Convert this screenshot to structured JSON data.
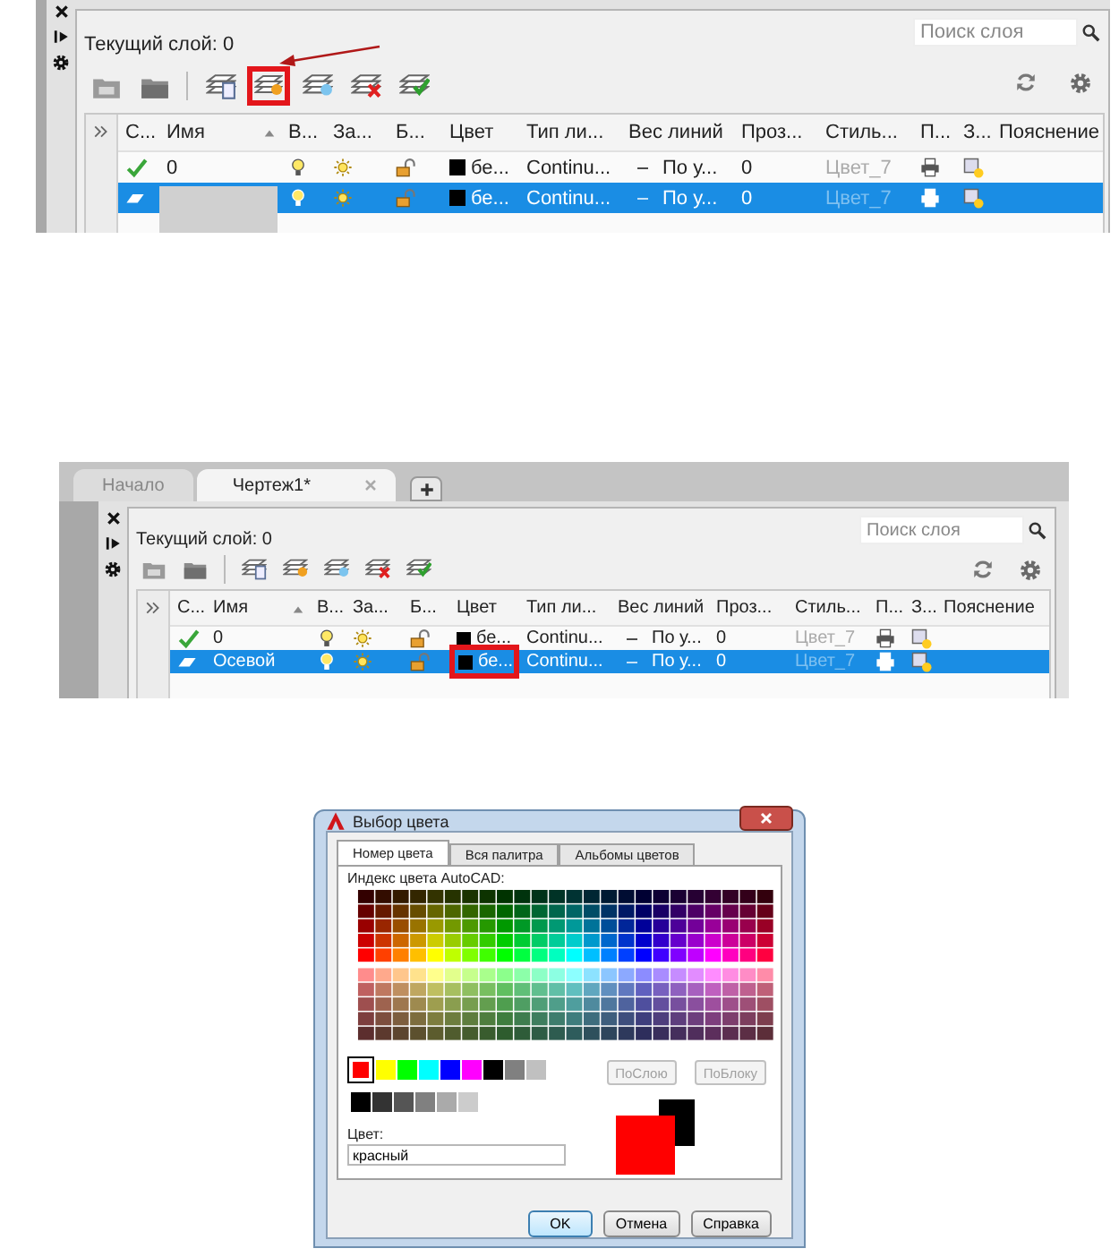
{
  "layer_panels": [
    {
      "current_layer": "Текущий слой: 0",
      "search": {
        "placeholder": "Поиск слоя"
      },
      "pointer_arrow": true,
      "toolbar": [
        {
          "kind": "new-filter",
          "highlighted": false
        },
        {
          "kind": "group-filter",
          "highlighted": false
        },
        {
          "kind": "states",
          "highlighted": false
        },
        {
          "kind": "new-layer",
          "highlighted": true
        },
        {
          "kind": "new-vp-layer",
          "highlighted": false
        },
        {
          "kind": "delete-layer",
          "highlighted": false
        },
        {
          "kind": "set-current",
          "highlighted": false
        }
      ],
      "columns": [
        {
          "label": "С...",
          "sorted": false
        },
        {
          "label": "Имя",
          "sorted": true
        },
        {
          "label": "В...",
          "sorted": false
        },
        {
          "label": "За...",
          "sorted": false
        },
        {
          "label": "Б...",
          "sorted": false
        },
        {
          "label": "Цвет",
          "sorted": false
        },
        {
          "label": "Тип ли...",
          "sorted": false
        },
        {
          "label": "Вес линий",
          "sorted": false
        },
        {
          "label": "Проз...",
          "sorted": false
        },
        {
          "label": "Стиль...",
          "sorted": false
        },
        {
          "label": "П...",
          "sorted": false
        },
        {
          "label": "З...",
          "sorted": false
        },
        {
          "label": "Пояснение",
          "sorted": false
        }
      ],
      "rows": [
        {
          "kind": "current",
          "selected": false,
          "name": "0",
          "redacted": false,
          "on": true,
          "frozen": false,
          "locked": false,
          "color": "#000000",
          "color_name": "бе...",
          "color_highlighted": false,
          "linetype": "Continu...",
          "lineweight": "По у...",
          "transparency": "0",
          "plot_style": "Цвет_7",
          "plot": true
        },
        {
          "kind": "layer",
          "selected": true,
          "redacted": true,
          "on": true,
          "frozen": false,
          "locked": false,
          "color": "#000000",
          "color_name": "бе...",
          "color_highlighted": false,
          "linetype": "Continu...",
          "lineweight": "По у...",
          "transparency": "0",
          "plot_style": "Цвет_7",
          "plot": true
        }
      ]
    },
    {
      "tabs": [
        {
          "label": "Начало",
          "selected": false,
          "closable": false
        },
        {
          "label": "Чертеж1*",
          "selected": true,
          "closable": true
        }
      ],
      "new_tab_button": true,
      "current_layer": "Текущий слой: 0",
      "search": {
        "placeholder": "Поиск слоя"
      },
      "pointer_arrow": false,
      "toolbar": [
        {
          "kind": "new-filter",
          "highlighted": false
        },
        {
          "kind": "group-filter",
          "highlighted": false
        },
        {
          "kind": "states",
          "highlighted": false
        },
        {
          "kind": "new-layer",
          "highlighted": false
        },
        {
          "kind": "new-vp-layer",
          "highlighted": false
        },
        {
          "kind": "delete-layer",
          "highlighted": false
        },
        {
          "kind": "set-current",
          "highlighted": false
        }
      ],
      "columns": [
        {
          "label": "С...",
          "sorted": false
        },
        {
          "label": "Имя",
          "sorted": true
        },
        {
          "label": "В...",
          "sorted": false
        },
        {
          "label": "За...",
          "sorted": false
        },
        {
          "label": "Б...",
          "sorted": false
        },
        {
          "label": "Цвет",
          "sorted": false
        },
        {
          "label": "Тип ли...",
          "sorted": false
        },
        {
          "label": "Вес линий",
          "sorted": false
        },
        {
          "label": "Проз...",
          "sorted": false
        },
        {
          "label": "Стиль...",
          "sorted": false
        },
        {
          "label": "П...",
          "sorted": false
        },
        {
          "label": "З...",
          "sorted": false
        },
        {
          "label": "Пояснение",
          "sorted": false
        }
      ],
      "rows": [
        {
          "kind": "current",
          "selected": false,
          "name": "0",
          "redacted": false,
          "on": true,
          "frozen": false,
          "locked": false,
          "color": "#000000",
          "color_name": "бе...",
          "color_highlighted": false,
          "linetype": "Continu...",
          "lineweight": "По у...",
          "transparency": "0",
          "plot_style": "Цвет_7",
          "plot": true
        },
        {
          "kind": "layer",
          "selected": true,
          "name": "Осевой",
          "redacted": false,
          "on": true,
          "frozen": false,
          "locked": false,
          "color": "#000000",
          "color_name": "бе...",
          "color_highlighted": true,
          "linetype": "Continu...",
          "lineweight": "По у...",
          "transparency": "0",
          "plot_style": "Цвет_7",
          "plot": true
        }
      ]
    }
  ],
  "dialog": {
    "title": "Выбор цвета",
    "tabs": [
      {
        "label": "Номер цвета",
        "selected": true
      },
      {
        "label": "Вся палитра",
        "selected": false
      },
      {
        "label": "Альбомы цветов",
        "selected": false
      }
    ],
    "index_label": "Индекс цвета AutoCAD:",
    "standard_colors": [
      {
        "color": "#ff0000",
        "selected": true
      },
      {
        "color": "#ffff00",
        "selected": false
      },
      {
        "color": "#00ff00",
        "selected": false
      },
      {
        "color": "#00ffff",
        "selected": false
      },
      {
        "color": "#0000ff",
        "selected": false
      },
      {
        "color": "#ff00ff",
        "selected": false
      },
      {
        "color": "#000000",
        "selected": false
      },
      {
        "color": "#808080",
        "selected": false
      },
      {
        "color": "#c0c0c0",
        "selected": false
      }
    ],
    "gray_colors": [
      {
        "color": "#000000",
        "selected": false
      },
      {
        "color": "#333333",
        "selected": false
      },
      {
        "color": "#555555",
        "selected": false
      },
      {
        "color": "#808080",
        "selected": false
      },
      {
        "color": "#aaaaaa",
        "selected": false
      },
      {
        "color": "#cccccc",
        "selected": false
      }
    ],
    "side_buttons": [
      {
        "label": "ПоСлою",
        "disabled": true
      },
      {
        "label": "ПоБлоку",
        "disabled": true
      }
    ],
    "color_label": "Цвет:",
    "color_value": "красный",
    "preview": [
      {
        "kind": "old",
        "color": "#000000"
      },
      {
        "kind": "new",
        "color": "#ff0000"
      }
    ],
    "buttons": [
      {
        "label": "OK",
        "default": true
      },
      {
        "label": "Отмена",
        "default": false
      },
      {
        "label": "Справка",
        "default": false
      }
    ]
  }
}
